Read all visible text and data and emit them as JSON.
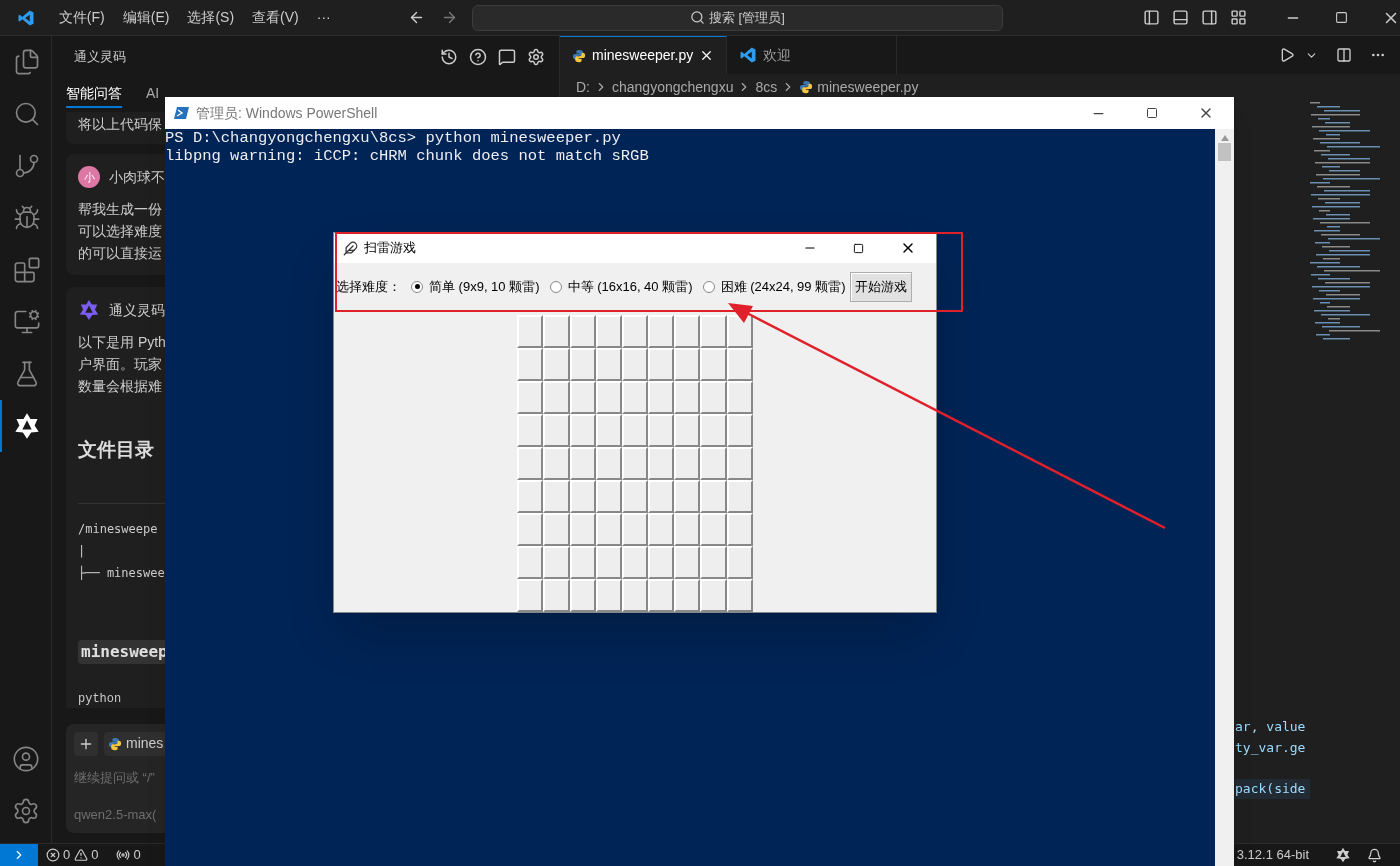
{
  "menu": [
    "文件(F)",
    "编辑(E)",
    "选择(S)",
    "查看(V)",
    "···"
  ],
  "search": {
    "value": "搜索 [管理员]"
  },
  "activity_bar": [
    {
      "kind": "files",
      "selected": false
    },
    {
      "kind": "search",
      "selected": false
    },
    {
      "kind": "git",
      "selected": false
    },
    {
      "kind": "debug",
      "selected": false
    },
    {
      "kind": "extensions",
      "selected": false
    },
    {
      "kind": "remote",
      "selected": false
    },
    {
      "kind": "testing",
      "selected": false
    },
    {
      "kind": "assistant",
      "selected": true
    }
  ],
  "chat_panel": {
    "title": "通义灵码",
    "tabs": [
      {
        "label": "智能问答",
        "selected": true
      },
      {
        "label": "AI",
        "selected": false
      }
    ],
    "snippet": "将以上代码保",
    "user_message": {
      "avatar": "小",
      "name": "小肉球不",
      "lines": [
        "帮我生成一份",
        "可以选择难度",
        "的可以直接运"
      ]
    },
    "assistant_message": {
      "name": "通义灵码",
      "lines": [
        "以下是用 Pyth",
        "户界面。玩家",
        "数量会根据难"
      ]
    },
    "heading": "文件目录",
    "tree_lines": [
      "/minesweepe",
      "|",
      "├── minesweе"
    ],
    "file_heading": "minesweep",
    "language": "python",
    "input": {
      "file": "mines",
      "placeholder": "继续提问或 “/”",
      "model": "qwen2.5-max("
    }
  },
  "editor": {
    "tabs": [
      {
        "label": "minesweeper.py",
        "selected": true,
        "kind": "python"
      },
      {
        "label": "欢迎",
        "selected": false,
        "kind": "vscode"
      }
    ],
    "breadcrumb": [
      "D:",
      "changyongchengxu",
      "8cs",
      "minesweeper.py"
    ],
    "code_lines": [
      {
        "text": "ar, value",
        "gap_before": false
      },
      {
        "text": "ty_var.ge",
        "gap_before": false
      },
      {
        "text": "pack(side",
        "gap_before": true
      }
    ]
  },
  "powershell": {
    "title": "管理员: Windows PowerShell",
    "lines": [
      "PS D:\\changyongchengxu\\8cs> python minesweeper.py",
      "libpng warning: iCCP: cHRM chunk does not match sRGB"
    ]
  },
  "minesweeper": {
    "title": "扫雷游戏",
    "difficulty_label": "选择难度：",
    "options": [
      {
        "label": "简单 (9x9, 10 颗雷)",
        "selected": true
      },
      {
        "label": "中等 (16x16, 40 颗雷)",
        "selected": false
      },
      {
        "label": "困难 (24x24, 99 颗雷)",
        "selected": false
      }
    ],
    "start_button": "开始游戏",
    "board": [
      [
        {
          "open": false
        },
        {
          "open": false
        },
        {
          "open": false
        },
        {
          "open": false
        },
        {
          "open": false
        },
        {
          "open": false
        },
        {
          "open": false
        },
        {
          "open": false
        },
        {
          "open": false
        }
      ],
      [
        {
          "open": false
        },
        {
          "open": false
        },
        {
          "open": false
        },
        {
          "open": false
        },
        {
          "open": false
        },
        {
          "open": false
        },
        {
          "open": false
        },
        {
          "open": false
        },
        {
          "open": false
        }
      ],
      [
        {
          "open": false
        },
        {
          "open": false
        },
        {
          "open": false
        },
        {
          "open": false
        },
        {
          "open": false
        },
        {
          "open": false
        },
        {
          "open": false
        },
        {
          "open": false
        },
        {
          "open": false
        }
      ],
      [
        {
          "open": false
        },
        {
          "open": false
        },
        {
          "open": false
        },
        {
          "open": false
        },
        {
          "open": false
        },
        {
          "open": false
        },
        {
          "open": false
        },
        {
          "open": false
        },
        {
          "open": false
        }
      ],
      [
        {
          "open": false
        },
        {
          "open": false
        },
        {
          "open": false
        },
        {
          "open": false
        },
        {
          "open": false
        },
        {
          "open": false
        },
        {
          "open": false
        },
        {
          "open": false
        },
        {
          "open": false
        }
      ],
      [
        {
          "open": false
        },
        {
          "open": false
        },
        {
          "open": false
        },
        {
          "open": false
        },
        {
          "open": false
        },
        {
          "open": false
        },
        {
          "open": false
        },
        {
          "open": false
        },
        {
          "open": false
        }
      ],
      [
        {
          "open": false
        },
        {
          "open": false
        },
        {
          "open": false
        },
        {
          "open": false
        },
        {
          "open": false
        },
        {
          "open": false
        },
        {
          "open": false
        },
        {
          "open": false
        },
        {
          "open": false
        }
      ],
      [
        {
          "open": false
        },
        {
          "open": false
        },
        {
          "open": false
        },
        {
          "open": false
        },
        {
          "open": false
        },
        {
          "open": false
        },
        {
          "open": false
        },
        {
          "open": false
        },
        {
          "open": false
        }
      ],
      [
        {
          "open": false
        },
        {
          "open": false
        },
        {
          "open": false
        },
        {
          "open": false
        },
        {
          "open": false
        },
        {
          "open": false
        },
        {
          "open": false
        },
        {
          "open": false
        },
        {
          "open": false
        }
      ]
    ]
  },
  "status_bar": {
    "errors": "0",
    "warnings": "0",
    "ports": "0",
    "interpreter": "3.12.1 64-bit"
  }
}
